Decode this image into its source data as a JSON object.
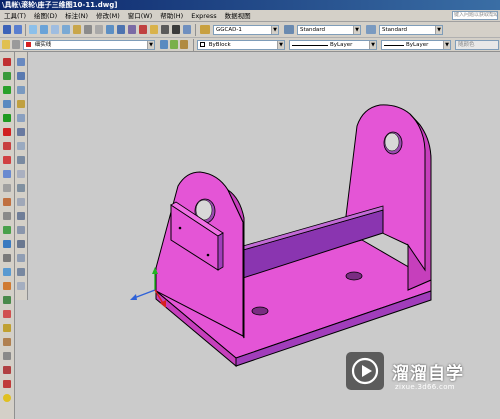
{
  "window": {
    "title": "\\具帐\\滚轮\\座子三维图10-11.dwg]"
  },
  "menu": {
    "items": [
      "工具(T)",
      "绘图(D)",
      "标注(N)",
      "修改(M)",
      "窗口(W)",
      "帮助(H)",
      "Express",
      "数据视图"
    ],
    "help_placeholder": "键入问题以获取帮助"
  },
  "toolbar1": {
    "text_style": "GGCAD-1",
    "dim_style": "Standard",
    "table_style": "Standard"
  },
  "toolbar2": {
    "layer": "细实线",
    "color": "ByBlock",
    "linetype": "ByLayer",
    "lineweight": "ByLayer",
    "plotstyle": "随颜色"
  },
  "watermark": {
    "title": "溜溜自学",
    "url": "zixue.3d66.com"
  },
  "colors": {
    "model_fill": "#e455d6",
    "model_side": "#c63fbc",
    "model_dark": "#8a35b0",
    "canvas": "#cbcbcb",
    "ui_face": "#d4d0c8"
  }
}
